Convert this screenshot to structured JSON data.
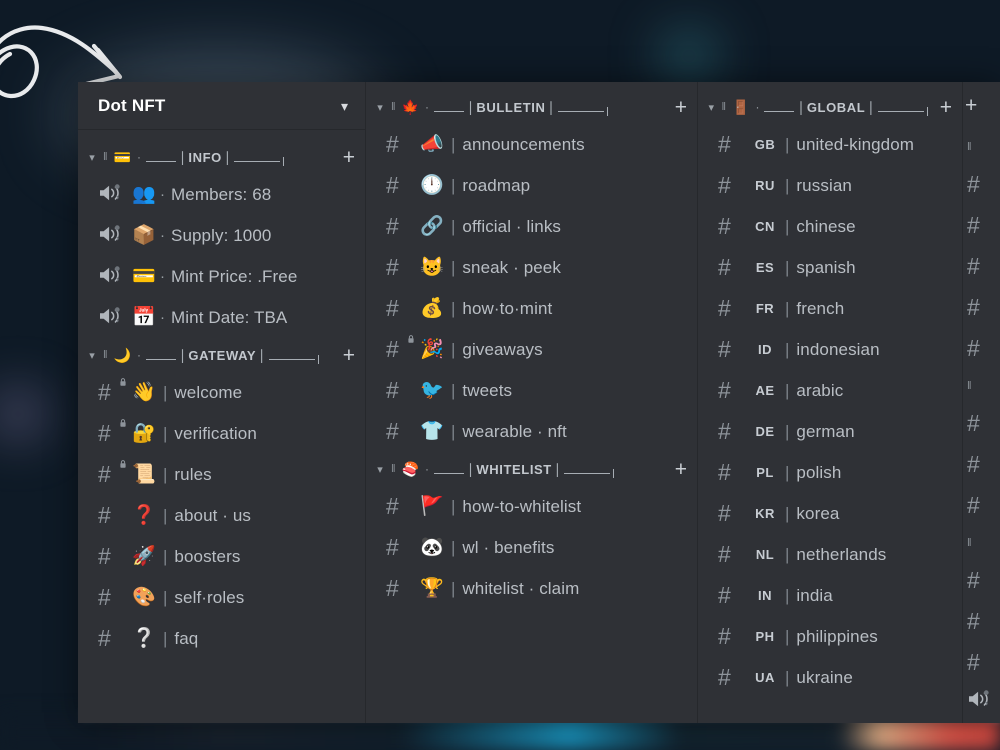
{
  "background": {
    "base_color": "#0e1a26",
    "glow_purple": "#9687b9",
    "glow_teal": "#3c96a5",
    "arrow_color": "#e8eaec"
  },
  "panel": {
    "background": "#2f3136",
    "divider": "#26282c"
  },
  "server": {
    "name": "Dot NFT",
    "collapse_icon": "chevron-down"
  },
  "columns": [
    {
      "id": "server",
      "categories": [
        {
          "id": "info",
          "chevron": "˅",
          "pause_glyph": "‖",
          "emoji": "💳",
          "dot": "·",
          "label": "INFO",
          "add_label": "+",
          "channels": [
            {
              "type": "voice",
              "emoji": "👥",
              "separator": "·",
              "name": "Members: 68",
              "locked": false
            },
            {
              "type": "voice",
              "emoji": "📦",
              "separator": "·",
              "name": "Supply: 1000",
              "locked": false
            },
            {
              "type": "voice",
              "emoji": "💳",
              "separator": "·",
              "name": "Mint Price: .Free",
              "locked": false
            },
            {
              "type": "voice",
              "emoji": "📅",
              "separator": "·",
              "name": "Mint Date: TBA",
              "locked": false
            }
          ]
        },
        {
          "id": "gateway",
          "chevron": "˅",
          "pause_glyph": "‖",
          "emoji": "🌙",
          "dot": "·",
          "label": "GATEWAY",
          "add_label": "+",
          "channels": [
            {
              "type": "text",
              "emoji": "👋",
              "separator": "|",
              "name": "welcome",
              "locked": true
            },
            {
              "type": "text",
              "emoji": "🔐",
              "separator": "|",
              "name": "verification",
              "locked": true
            },
            {
              "type": "text",
              "emoji": "📜",
              "separator": "|",
              "name": "rules",
              "locked": true
            },
            {
              "type": "text",
              "emoji": "❓",
              "separator": "|",
              "name": "about · us",
              "locked": false
            },
            {
              "type": "text",
              "emoji": "🚀",
              "separator": "|",
              "name": "boosters",
              "locked": false
            },
            {
              "type": "text",
              "emoji": "🎨",
              "separator": "|",
              "name": "self·roles",
              "locked": false
            },
            {
              "type": "text",
              "emoji": "❔",
              "separator": "|",
              "name": "faq",
              "locked": false
            }
          ]
        }
      ]
    },
    {
      "id": "bulletin",
      "categories": [
        {
          "id": "bulletin",
          "chevron": "˅",
          "pause_glyph": "‖",
          "emoji": "🍁",
          "dot": "·",
          "label": "BULLETIN",
          "add_label": "+",
          "channels": [
            {
              "type": "text",
              "emoji": "📣",
              "separator": "|",
              "name": "announcements",
              "locked": false
            },
            {
              "type": "text",
              "emoji": "🕛",
              "separator": "|",
              "name": "roadmap",
              "locked": false
            },
            {
              "type": "text",
              "emoji": "🔗",
              "separator": "|",
              "name": "official · links",
              "locked": false
            },
            {
              "type": "text",
              "emoji": "😺",
              "separator": "|",
              "name": "sneak · peek",
              "locked": false
            },
            {
              "type": "text",
              "emoji": "💰",
              "separator": "|",
              "name": "how·to·mint",
              "locked": false
            },
            {
              "type": "text",
              "emoji": "🎉",
              "separator": "|",
              "name": "giveaways",
              "locked": true
            },
            {
              "type": "text",
              "emoji": "🐦",
              "separator": "|",
              "name": "tweets",
              "locked": false
            },
            {
              "type": "text",
              "emoji": "👕",
              "separator": "|",
              "name": "wearable · nft",
              "locked": false
            }
          ]
        },
        {
          "id": "whitelist",
          "chevron": "˅",
          "pause_glyph": "‖",
          "emoji": "🍣",
          "dot": "·",
          "label": "WHITELIST",
          "add_label": "+",
          "channels": [
            {
              "type": "text",
              "emoji": "🚩",
              "separator": "|",
              "name": "how-to-whitelist",
              "locked": false
            },
            {
              "type": "text",
              "emoji": "🐼",
              "separator": "|",
              "name": "wl · benefits",
              "locked": false
            },
            {
              "type": "text",
              "emoji": "🏆",
              "separator": "|",
              "name": "whitelist · claim",
              "locked": false
            }
          ]
        }
      ]
    },
    {
      "id": "global",
      "categories": [
        {
          "id": "global",
          "chevron": "˅",
          "pause_glyph": "‖",
          "emoji": "🚪",
          "dot": "·",
          "label": "GLOBAL",
          "add_label": "+",
          "channels": [
            {
              "type": "text",
              "flag": "GB",
              "separator": "|",
              "name": "united-kingdom"
            },
            {
              "type": "text",
              "flag": "RU",
              "separator": "|",
              "name": "russian"
            },
            {
              "type": "text",
              "flag": "CN",
              "separator": "|",
              "name": "chinese"
            },
            {
              "type": "text",
              "flag": "ES",
              "separator": "|",
              "name": "spanish"
            },
            {
              "type": "text",
              "flag": "FR",
              "separator": "|",
              "name": "french"
            },
            {
              "type": "text",
              "flag": "ID",
              "separator": "|",
              "name": "indonesian"
            },
            {
              "type": "text",
              "flag": "AE",
              "separator": "|",
              "name": "arabic"
            },
            {
              "type": "text",
              "flag": "DE",
              "separator": "|",
              "name": "german"
            },
            {
              "type": "text",
              "flag": "PL",
              "separator": "|",
              "name": "polish"
            },
            {
              "type": "text",
              "flag": "KR",
              "separator": "|",
              "name": "korea"
            },
            {
              "type": "text",
              "flag": "NL",
              "separator": "|",
              "name": "netherlands"
            },
            {
              "type": "text",
              "flag": "IN",
              "separator": "|",
              "name": "india"
            },
            {
              "type": "text",
              "flag": "PH",
              "separator": "|",
              "name": "philippines"
            },
            {
              "type": "text",
              "flag": "UA",
              "separator": "|",
              "name": "ukraine"
            }
          ]
        }
      ]
    }
  ],
  "clipped_column": {
    "add_label": "+",
    "rows": [
      {
        "kind": "cat"
      },
      {
        "kind": "hash"
      },
      {
        "kind": "hash"
      },
      {
        "kind": "hash"
      },
      {
        "kind": "hash"
      },
      {
        "kind": "hash"
      },
      {
        "kind": "cat"
      },
      {
        "kind": "hash"
      },
      {
        "kind": "hash"
      },
      {
        "kind": "hash"
      },
      {
        "kind": "cat"
      },
      {
        "kind": "hash"
      },
      {
        "kind": "hash"
      },
      {
        "kind": "hash"
      },
      {
        "kind": "vol"
      }
    ],
    "hash_glyph": "#",
    "cat_glyph": "‖",
    "vol_glyph": "🔊"
  }
}
